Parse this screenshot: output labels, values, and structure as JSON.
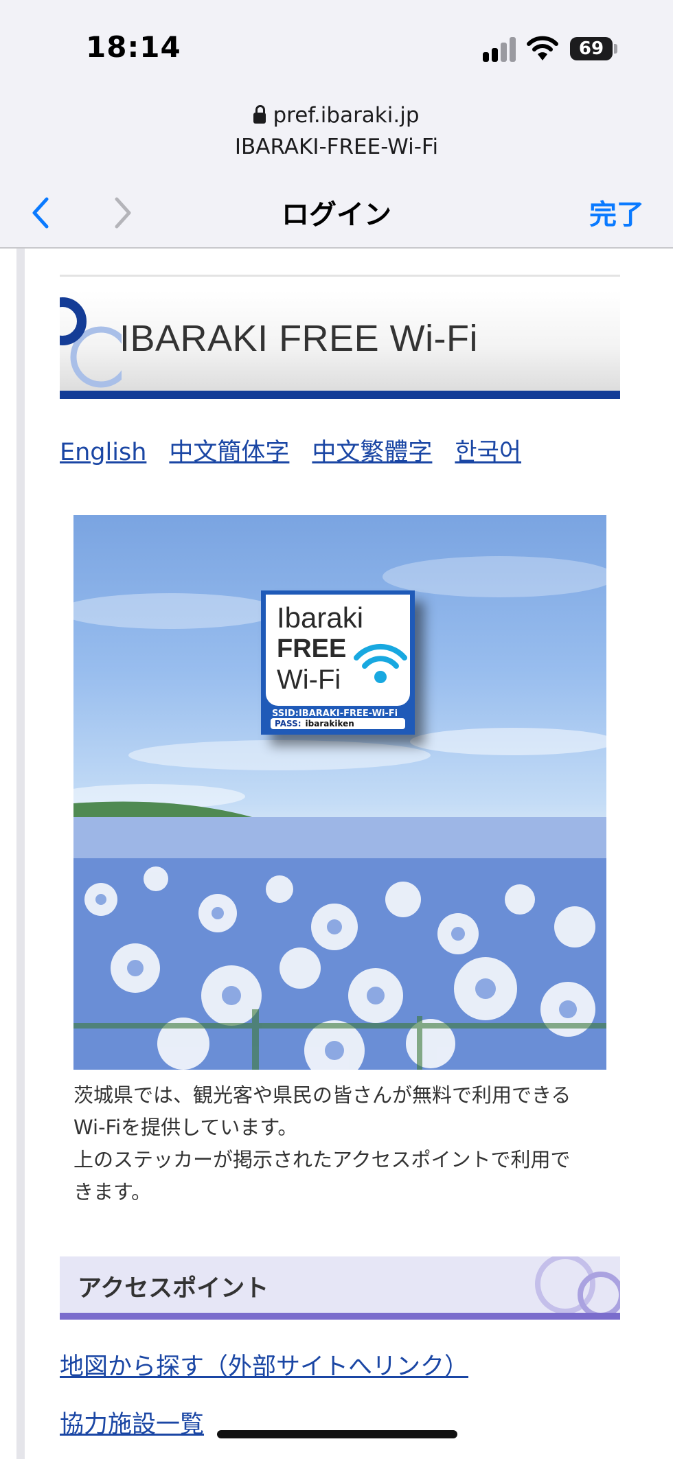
{
  "status_bar": {
    "time": "18:14",
    "battery": "69"
  },
  "browser": {
    "domain": "pref.ibaraki.jp",
    "page_title": "IBARAKI-FREE-Wi-Fi",
    "nav_title": "ログイン",
    "done_label": "完了"
  },
  "header": {
    "title": "IBARAKI FREE Wi-Fi"
  },
  "languages": [
    "English",
    "中文簡体字",
    "中文繁體字",
    "한국어"
  ],
  "sticker": {
    "line1": "Ibaraki",
    "line2": "FREE",
    "line3": "Wi-Fi",
    "ssid": "SSID:IBARAKI-FREE-Wi-Fi",
    "pass_label": "PASS:",
    "pass_value": "ibarakiken"
  },
  "description": {
    "line1": "茨城県では、観光客や県民の皆さんが無料で利用できる",
    "line2": "Wi-Fiを提供しています。",
    "line3": "上のステッカーが掲示されたアクセスポイントで利用で",
    "line4": "きます。"
  },
  "access_section": {
    "title": "アクセスポイント",
    "links": [
      "地図から探す（外部サイトへリンク）",
      "協力施設一覧"
    ]
  },
  "colors": {
    "accent_blue": "#0a7aff",
    "header_bar": "#123c97",
    "section_bar": "#7a6ccc",
    "link": "#1a46a4"
  }
}
